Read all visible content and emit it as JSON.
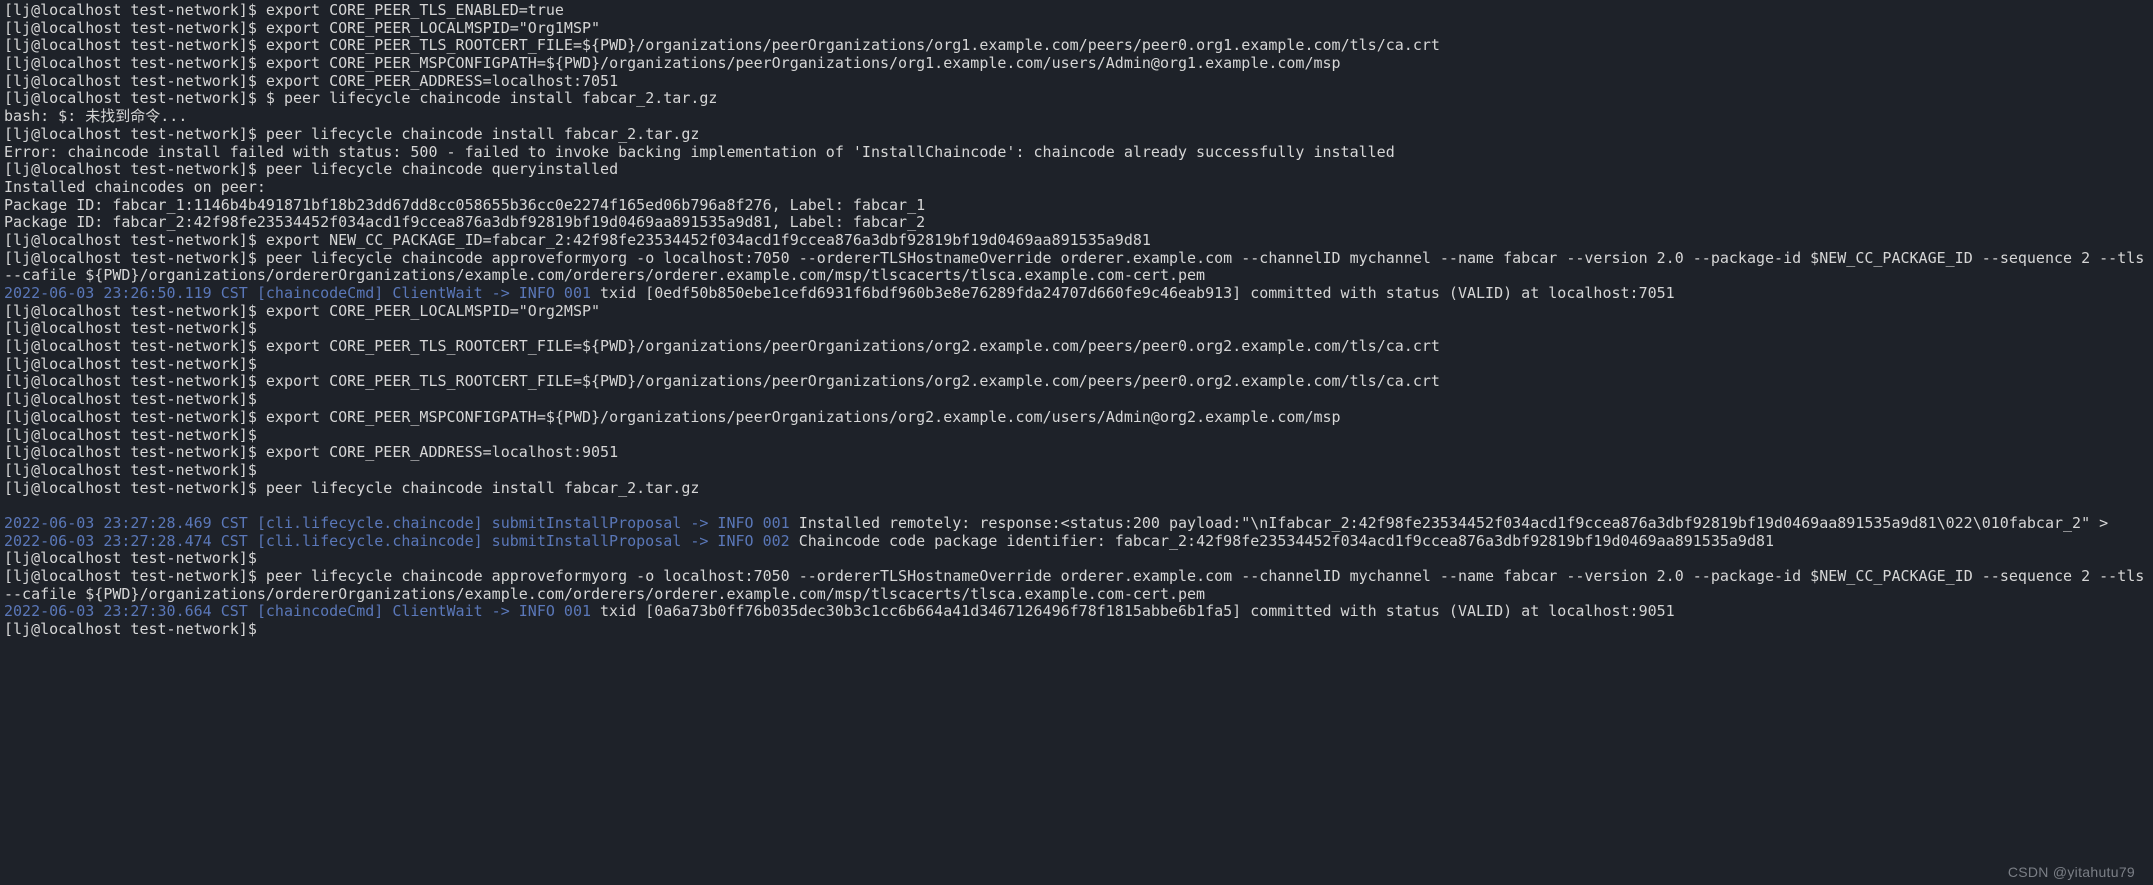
{
  "prompt": "[lj@localhost test-network]$ ",
  "lines": [
    {
      "segs": [
        {
          "t": "prompt"
        },
        {
          "c": "normal",
          "txt": "export CORE_PEER_TLS_ENABLED=true"
        }
      ]
    },
    {
      "segs": [
        {
          "t": "prompt"
        },
        {
          "c": "normal",
          "txt": "export CORE_PEER_LOCALMSPID=\"Org1MSP\""
        }
      ]
    },
    {
      "segs": [
        {
          "t": "prompt"
        },
        {
          "c": "normal",
          "txt": "export CORE_PEER_TLS_ROOTCERT_FILE=${PWD}/organizations/peerOrganizations/org1.example.com/peers/peer0.org1.example.com/tls/ca.crt"
        }
      ]
    },
    {
      "segs": [
        {
          "t": "prompt"
        },
        {
          "c": "normal",
          "txt": "export CORE_PEER_MSPCONFIGPATH=${PWD}/organizations/peerOrganizations/org1.example.com/users/Admin@org1.example.com/msp"
        }
      ]
    },
    {
      "segs": [
        {
          "t": "prompt"
        },
        {
          "c": "normal",
          "txt": "export CORE_PEER_ADDRESS=localhost:7051"
        }
      ]
    },
    {
      "segs": [
        {
          "t": "prompt"
        },
        {
          "c": "normal",
          "txt": "$ peer lifecycle chaincode install fabcar_2.tar.gz"
        }
      ]
    },
    {
      "segs": [
        {
          "c": "normal",
          "txt": "bash: $: 未找到命令..."
        }
      ]
    },
    {
      "segs": [
        {
          "t": "prompt"
        },
        {
          "c": "normal",
          "txt": "peer lifecycle chaincode install fabcar_2.tar.gz"
        }
      ]
    },
    {
      "segs": [
        {
          "c": "normal",
          "txt": "Error: chaincode install failed with status: 500 - failed to invoke backing implementation of 'InstallChaincode': chaincode already successfully installed"
        }
      ]
    },
    {
      "segs": [
        {
          "t": "prompt"
        },
        {
          "c": "normal",
          "txt": "peer lifecycle chaincode queryinstalled"
        }
      ]
    },
    {
      "segs": [
        {
          "c": "normal",
          "txt": "Installed chaincodes on peer:"
        }
      ]
    },
    {
      "segs": [
        {
          "c": "normal",
          "txt": "Package ID: fabcar_1:1146b4b491871bf18b23dd67dd8cc058655b36cc0e2274f165ed06b796a8f276, Label: fabcar_1"
        }
      ]
    },
    {
      "segs": [
        {
          "c": "normal",
          "txt": "Package ID: fabcar_2:42f98fe23534452f034acd1f9ccea876a3dbf92819bf19d0469aa891535a9d81, Label: fabcar_2"
        }
      ]
    },
    {
      "segs": [
        {
          "t": "prompt"
        },
        {
          "c": "normal",
          "txt": "export NEW_CC_PACKAGE_ID=fabcar_2:42f98fe23534452f034acd1f9ccea876a3dbf92819bf19d0469aa891535a9d81"
        }
      ]
    },
    {
      "segs": [
        {
          "t": "prompt"
        },
        {
          "c": "normal",
          "txt": "peer lifecycle chaincode approveformyorg -o localhost:7050 --ordererTLSHostnameOverride orderer.example.com --channelID mychannel --name fabcar --version 2.0 --package-id $NEW_CC_PACKAGE_ID --sequence 2 --tls --cafile ${PWD}/organizations/ordererOrganizations/example.com/orderers/orderer.example.com/msp/tlscacerts/tlsca.example.com-cert.pem"
        }
      ]
    },
    {
      "segs": [
        {
          "c": "log-prefix",
          "txt": "2022-06-03 23:26:50.119 CST [chaincodeCmd] ClientWait -> INFO 001"
        },
        {
          "c": "normal",
          "txt": " txid [0edf50b850ebe1cefd6931f6bdf960b3e8e76289fda24707d660fe9c46eab913] committed with status (VALID) at localhost:7051"
        }
      ]
    },
    {
      "segs": [
        {
          "t": "prompt"
        },
        {
          "c": "normal",
          "txt": "export CORE_PEER_LOCALMSPID=\"Org2MSP\""
        }
      ]
    },
    {
      "segs": [
        {
          "t": "prompt"
        }
      ]
    },
    {
      "segs": [
        {
          "t": "prompt"
        },
        {
          "c": "normal",
          "txt": "export CORE_PEER_TLS_ROOTCERT_FILE=${PWD}/organizations/peerOrganizations/org2.example.com/peers/peer0.org2.example.com/tls/ca.crt"
        }
      ]
    },
    {
      "segs": [
        {
          "t": "prompt"
        }
      ]
    },
    {
      "segs": [
        {
          "t": "prompt"
        },
        {
          "c": "normal",
          "txt": "export CORE_PEER_TLS_ROOTCERT_FILE=${PWD}/organizations/peerOrganizations/org2.example.com/peers/peer0.org2.example.com/tls/ca.crt"
        }
      ]
    },
    {
      "segs": [
        {
          "t": "prompt"
        }
      ]
    },
    {
      "segs": [
        {
          "t": "prompt"
        },
        {
          "c": "normal",
          "txt": "export CORE_PEER_MSPCONFIGPATH=${PWD}/organizations/peerOrganizations/org2.example.com/users/Admin@org2.example.com/msp"
        }
      ]
    },
    {
      "segs": [
        {
          "t": "prompt"
        }
      ]
    },
    {
      "segs": [
        {
          "t": "prompt"
        },
        {
          "c": "normal",
          "txt": "export CORE_PEER_ADDRESS=localhost:9051"
        }
      ]
    },
    {
      "segs": [
        {
          "t": "prompt"
        }
      ]
    },
    {
      "segs": [
        {
          "t": "prompt"
        },
        {
          "c": "normal",
          "txt": "peer lifecycle chaincode install fabcar_2.tar.gz"
        }
      ]
    },
    {
      "segs": [
        {
          "c": "normal",
          "txt": " "
        }
      ]
    },
    {
      "segs": [
        {
          "c": "log-prefix",
          "txt": "2022-06-03 23:27:28.469 CST [cli.lifecycle.chaincode] submitInstallProposal -> INFO 001"
        },
        {
          "c": "normal",
          "txt": " Installed remotely: response:<status:200 payload:\"\\nIfabcar_2:42f98fe23534452f034acd1f9ccea876a3dbf92819bf19d0469aa891535a9d81\\022\\010fabcar_2\" >"
        }
      ]
    },
    {
      "segs": [
        {
          "c": "log-prefix",
          "txt": "2022-06-03 23:27:28.474 CST [cli.lifecycle.chaincode] submitInstallProposal -> INFO 002"
        },
        {
          "c": "normal",
          "txt": " Chaincode code package identifier: fabcar_2:42f98fe23534452f034acd1f9ccea876a3dbf92819bf19d0469aa891535a9d81"
        }
      ]
    },
    {
      "segs": [
        {
          "t": "prompt"
        }
      ]
    },
    {
      "segs": [
        {
          "t": "prompt"
        },
        {
          "c": "normal",
          "txt": "peer lifecycle chaincode approveformyorg -o localhost:7050 --ordererTLSHostnameOverride orderer.example.com --channelID mychannel --name fabcar --version 2.0 --package-id $NEW_CC_PACKAGE_ID --sequence 2 --tls --cafile ${PWD}/organizations/ordererOrganizations/example.com/orderers/orderer.example.com/msp/tlscacerts/tlsca.example.com-cert.pem"
        }
      ]
    },
    {
      "segs": [
        {
          "c": "log-prefix",
          "txt": "2022-06-03 23:27:30.664 CST [chaincodeCmd] ClientWait -> INFO 001"
        },
        {
          "c": "normal",
          "txt": " txid [0a6a73b0ff76b035dec30b3c1cc6b664a41d3467126496f78f1815abbe6b1fa5] committed with status (VALID) at localhost:9051"
        }
      ]
    },
    {
      "segs": [
        {
          "t": "prompt"
        }
      ]
    }
  ],
  "watermark": "CSDN @yitahutu79"
}
